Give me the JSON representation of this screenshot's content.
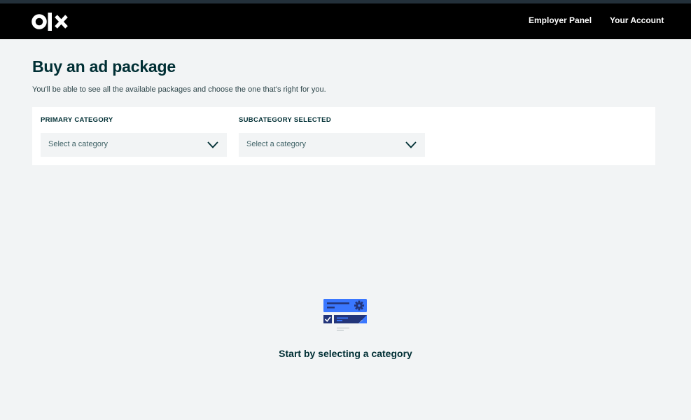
{
  "header": {
    "logo_text": "olx",
    "nav": {
      "employer_panel": "Employer Panel",
      "your_account": "Your Account"
    }
  },
  "main": {
    "title": "Buy an ad package",
    "subtitle": "You'll be able to see all the available packages and choose the one that's right for you.",
    "filters": {
      "primary": {
        "label": "PRIMARY CATEGORY",
        "value": "Select a category",
        "icon": "chevron-down-icon"
      },
      "subcategory": {
        "label": "SUBCATEGORY SELECTED",
        "value": "Select a category",
        "icon": "chevron-down-icon"
      }
    },
    "empty_state": {
      "icon": "package-selection-illustration",
      "message": "Start by selecting a category"
    }
  },
  "colors": {
    "header_bg": "#000000",
    "page_bg": "#f2f4f5",
    "text_primary": "#002f34",
    "accent_blue": "#3a77ff",
    "dark_blue": "#23357a"
  }
}
